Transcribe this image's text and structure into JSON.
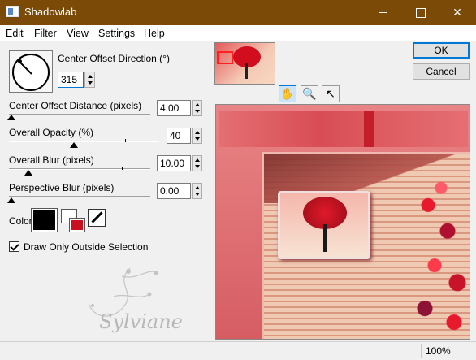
{
  "window": {
    "title": "Shadowlab",
    "minimize_glyph": "",
    "maximize_glyph": "",
    "close_glyph": "✕"
  },
  "menu": {
    "items": [
      "Edit",
      "Filter",
      "View",
      "Settings",
      "Help"
    ]
  },
  "direction": {
    "label": "Center Offset Direction (°)",
    "value": "315"
  },
  "controls": [
    {
      "label": "Center Offset Distance (pixels)",
      "value": "4.00",
      "level": 0.04
    },
    {
      "label": "Overall Opacity (%)",
      "value": "40",
      "level": 0.4
    },
    {
      "label": "Overall Blur (pixels)",
      "value": "10.00",
      "level": 0.1
    },
    {
      "label": "Perspective Blur (pixels)",
      "value": "0.00",
      "level": 0.0
    }
  ],
  "color": {
    "label": "Color",
    "primary": "#000000",
    "secondary": "#c8101e"
  },
  "checkbox": {
    "label": "Draw Only Outside Selection",
    "checked": true
  },
  "buttons": {
    "ok": "OK",
    "cancel": "Cancel"
  },
  "tools": {
    "hand": "✋",
    "zoom": "🔍",
    "pointer": "↖"
  },
  "watermark": {
    "text": "Sylviane"
  },
  "status": {
    "zoom": "100%"
  },
  "colors": {
    "titlebar": "#7a4a06",
    "accent": "#0078d7"
  }
}
